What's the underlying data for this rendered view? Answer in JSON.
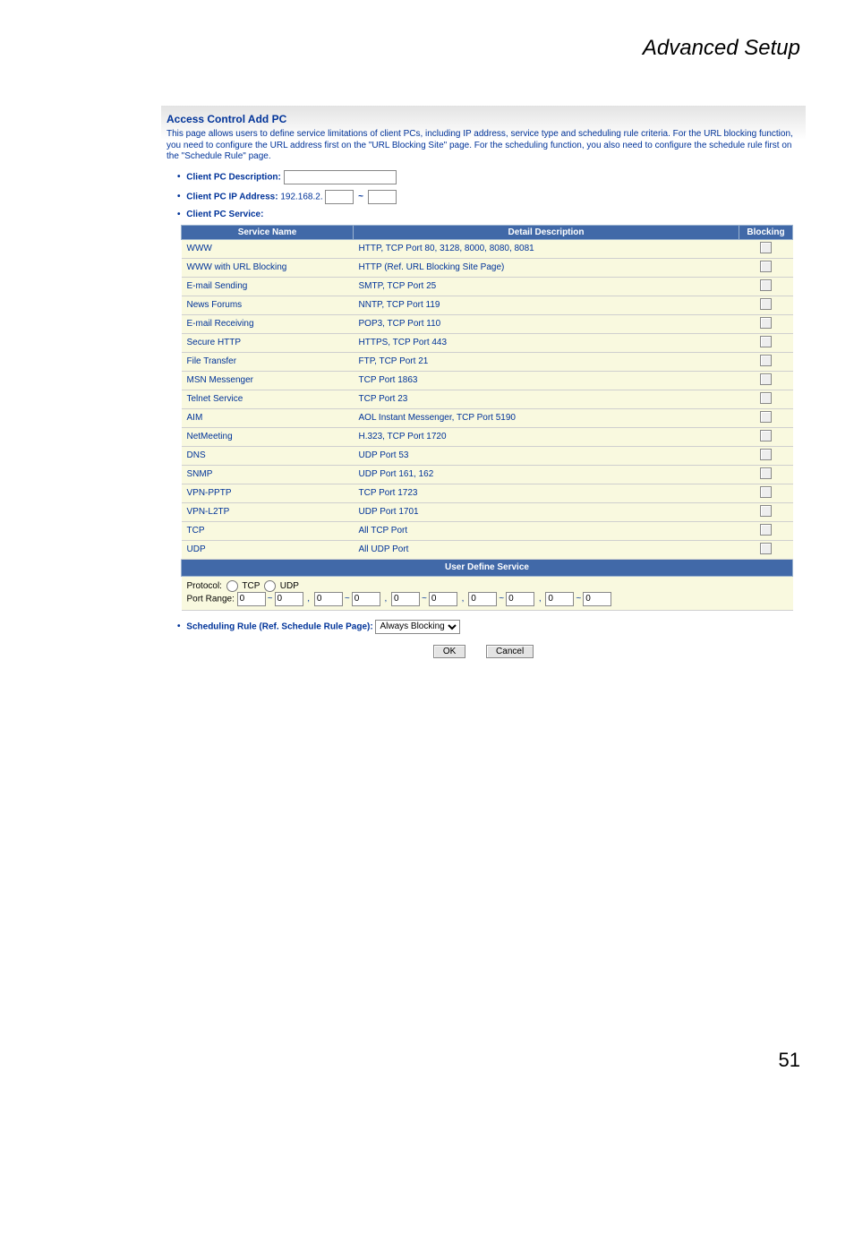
{
  "doc": {
    "title": "Advanced Setup",
    "page_number": "51"
  },
  "panel": {
    "title": "Access Control Add PC",
    "help": "This page allows users to define service limitations of client PCs, including IP address, service type and scheduling rule criteria. For the URL blocking function, you need to configure the URL address first on the \"URL Blocking Site\" page. For the scheduling function, you also need to configure the schedule rule first on the \"Schedule Rule\" page.",
    "desc_label": "Client PC Description:",
    "desc_value": "",
    "ip_label": "Client PC IP Address:",
    "ip_prefix": "192.168.2.",
    "ip_tilde": "~",
    "ip_a": "",
    "ip_b": "",
    "svc_label": "Client PC Service:"
  },
  "table": {
    "h_name": "Service Name",
    "h_desc": "Detail Description",
    "h_block": "Blocking",
    "user_header": "User Define Service",
    "rows": [
      {
        "name": "WWW",
        "desc": "HTTP, TCP Port 80, 3128, 8000, 8080, 8081"
      },
      {
        "name": "WWW with URL Blocking",
        "desc": "HTTP (Ref. URL Blocking Site Page)"
      },
      {
        "name": "E-mail Sending",
        "desc": "SMTP, TCP Port 25"
      },
      {
        "name": "News Forums",
        "desc": "NNTP, TCP Port 119"
      },
      {
        "name": "E-mail Receiving",
        "desc": "POP3, TCP Port 110"
      },
      {
        "name": "Secure HTTP",
        "desc": "HTTPS, TCP Port 443"
      },
      {
        "name": "File Transfer",
        "desc": "FTP, TCP Port 21"
      },
      {
        "name": "MSN Messenger",
        "desc": "TCP Port 1863"
      },
      {
        "name": "Telnet Service",
        "desc": "TCP Port 23"
      },
      {
        "name": "AIM",
        "desc": "AOL Instant Messenger, TCP Port 5190"
      },
      {
        "name": "NetMeeting",
        "desc": "H.323, TCP Port 1720"
      },
      {
        "name": "DNS",
        "desc": "UDP Port 53"
      },
      {
        "name": "SNMP",
        "desc": "UDP Port 161, 162"
      },
      {
        "name": "VPN-PPTP",
        "desc": "TCP Port 1723"
      },
      {
        "name": "VPN-L2TP",
        "desc": "UDP Port 1701"
      },
      {
        "name": "TCP",
        "desc": "All TCP Port"
      },
      {
        "name": "UDP",
        "desc": "All UDP Port"
      }
    ]
  },
  "user": {
    "proto_label": "Protocol:",
    "proto_tcp": "TCP",
    "proto_udp": "UDP",
    "portrange_label": "Port Range:",
    "port_default": "0",
    "tilde": "~",
    "comma": ","
  },
  "sched": {
    "label": "Scheduling Rule (Ref. Schedule Rule Page):",
    "selected": "Always Blocking"
  },
  "buttons": {
    "ok": "OK",
    "cancel": "Cancel"
  }
}
